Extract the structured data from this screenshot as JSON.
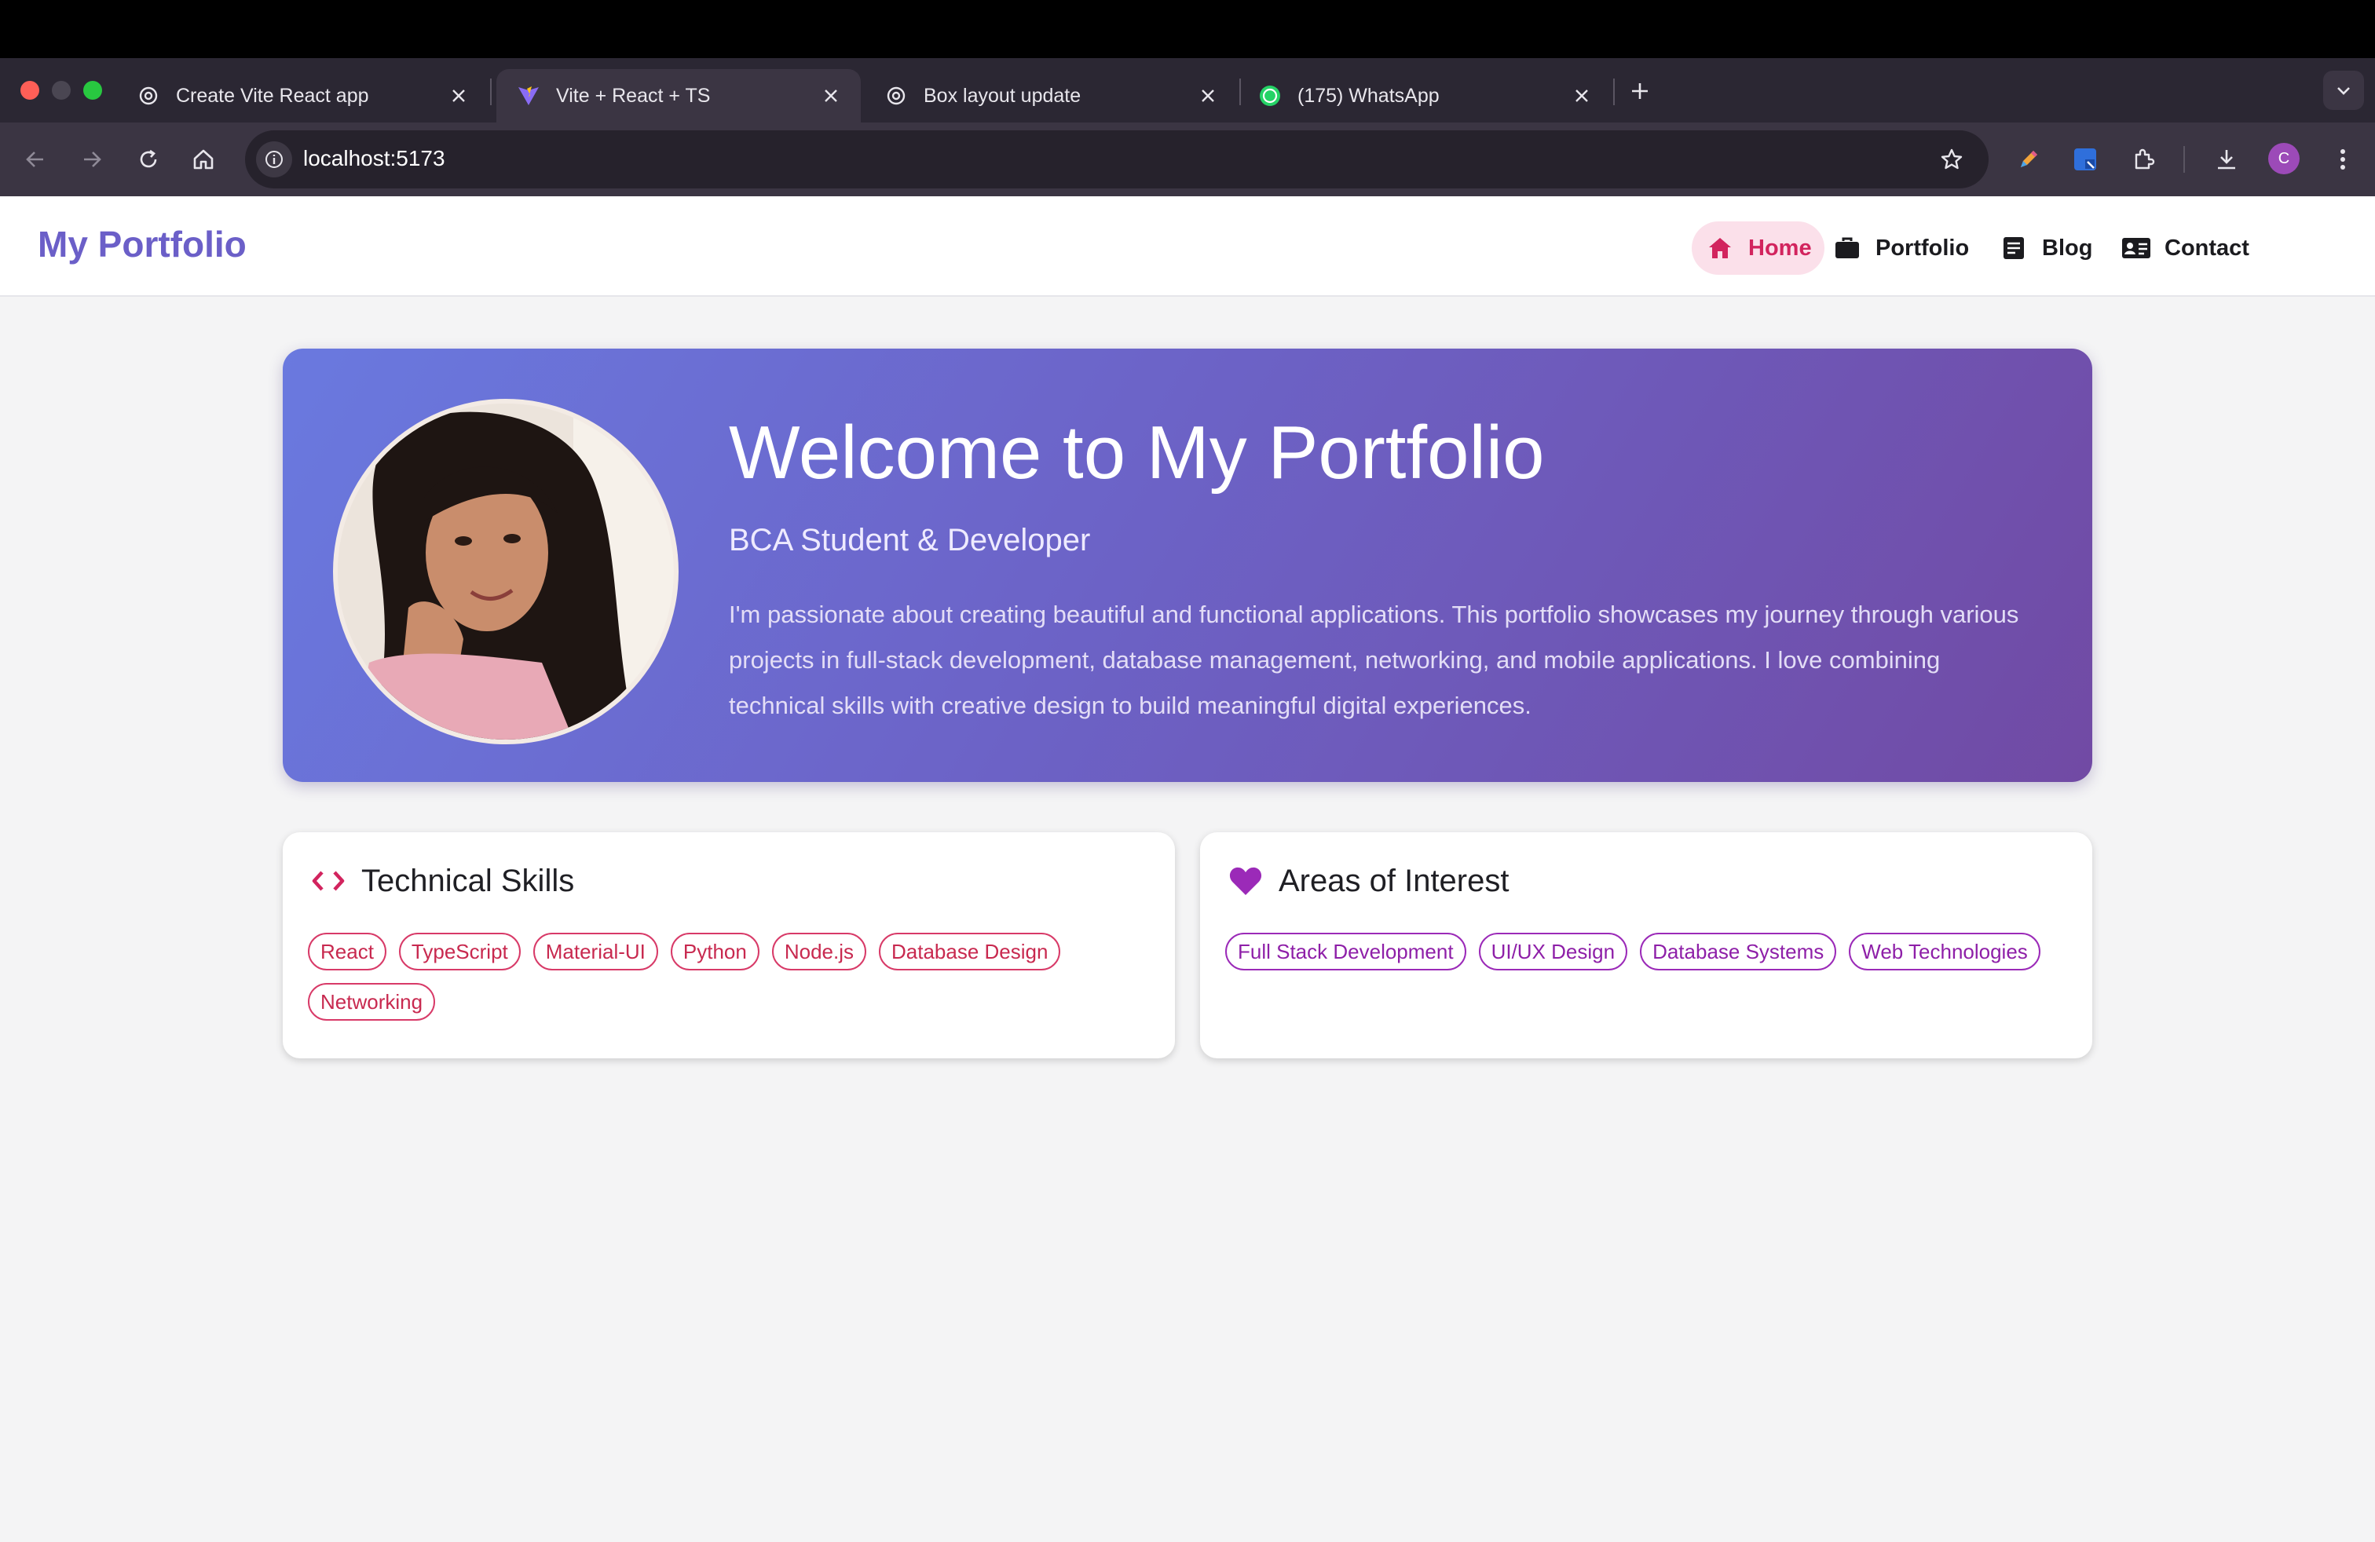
{
  "browser": {
    "tabs": [
      {
        "title": "Create Vite React app",
        "icon": "openai-icon",
        "active": false
      },
      {
        "title": "Vite + React + TS",
        "icon": "vite-icon",
        "active": true
      },
      {
        "title": "Box layout update",
        "icon": "openai-icon",
        "active": false
      },
      {
        "title": "(175) WhatsApp",
        "icon": "whatsapp-icon",
        "active": false
      }
    ],
    "url": "localhost:5173",
    "profile_initial": "C"
  },
  "app": {
    "brand": "My Portfolio",
    "nav": [
      {
        "label": "Home",
        "icon": "home-icon",
        "active": true
      },
      {
        "label": "Portfolio",
        "icon": "briefcase-icon",
        "active": false
      },
      {
        "label": "Blog",
        "icon": "article-icon",
        "active": false
      },
      {
        "label": "Contact",
        "icon": "contact-card-icon",
        "active": false
      }
    ]
  },
  "hero": {
    "title": "Welcome to My Portfolio",
    "subtitle": "BCA Student & Developer",
    "description": "I'm passionate about creating beautiful and functional applications. This portfolio showcases my journey through various projects in full-stack development, database management, networking, and mobile applications. I love combining technical skills with creative design to build meaningful digital experiences."
  },
  "skills": {
    "title": "Technical Skills",
    "icon": "code-icon",
    "items": [
      "React",
      "TypeScript",
      "Material-UI",
      "Python",
      "Node.js",
      "Database Design",
      "Networking"
    ]
  },
  "interests": {
    "title": "Areas of Interest",
    "icon": "heart-icon",
    "items": [
      "Full Stack Development",
      "UI/UX Design",
      "Database Systems",
      "Web Technologies"
    ]
  },
  "colors": {
    "brand": "#6b5fc8",
    "nav_active": "#d2245e",
    "skill_chip": "#c8294f",
    "interest_chip": "#8e1fa8"
  }
}
